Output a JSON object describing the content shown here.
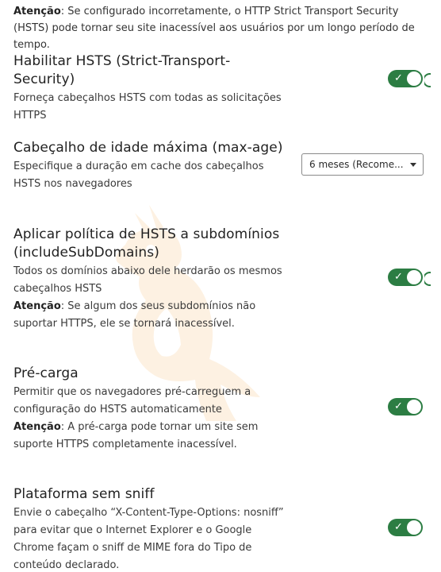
{
  "top_warning": {
    "label": "Atenção",
    "text": ": Se configurado incorretamente, o HTTP Strict Transport Security (HSTS) pode tornar seu site inacessível aos usuários por um longo período de tempo."
  },
  "settings": [
    {
      "title": "Habilitar HSTS (Strict-Transport-Security)",
      "description": "Forneça cabeçalhos HSTS com todas as solicitações HTTPS",
      "enabled": true
    },
    {
      "title": "Cabeçalho de idade máxima (max-age)",
      "description": "Especifique a duração em cache dos cabeçalhos HSTS nos navegadores",
      "selected_option": "6 meses (Recome..."
    },
    {
      "title": "Aplicar política de HSTS a subdomínios (includeSubDomains)",
      "description": "Todos os domínios abaixo dele herdarão os mesmos cabeçalhos HSTS",
      "warning_label": "Atenção",
      "warning_text": ": Se algum dos seus subdomínios não suportar HTTPS, ele se tornará inacessível.",
      "enabled": true
    },
    {
      "title": "Pré-carga",
      "description": "Permitir que os navegadores pré-carreguem a configuração do HSTS automaticamente",
      "warning_label": "Atenção",
      "warning_text": ": A pré-carga pode tornar um site sem suporte HTTPS completamente inacessível.",
      "enabled": true
    },
    {
      "title": "Plataforma sem sniff",
      "description": "Envie o cabeçalho “X-Content-Type-Options: nosniff” para evitar que o Internet Explorer e o Google Chrome façam o sniff de MIME fora do Tipo de conteúdo declarado.",
      "enabled": true
    }
  ],
  "icons": {
    "toggle_check": "✓",
    "watermark": "kangaroo-watermark-icon",
    "dropdown": "chevron-down-icon"
  },
  "colors": {
    "toggle_on": "#2c7d43",
    "watermark": "#fdf0e0"
  }
}
